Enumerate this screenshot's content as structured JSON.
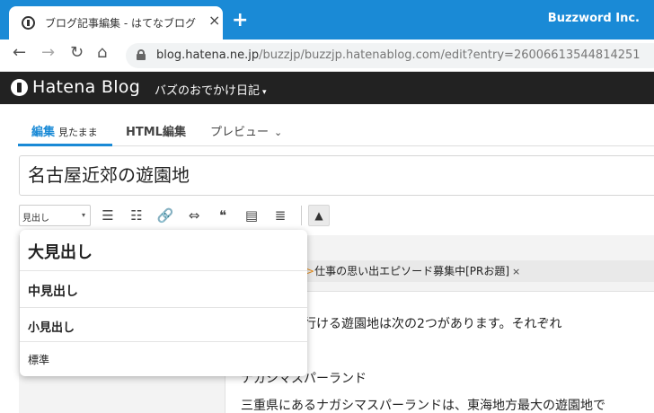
{
  "browser": {
    "tab_title": "ブログ記事編集 - はてなブログ",
    "tab_close": "×",
    "new_tab": "+",
    "profile": "Buzzword Inc.",
    "nav": {
      "back": "←",
      "forward": "→",
      "reload": "↻",
      "home": "⌂"
    },
    "url_host": "blog.hatena.ne.jp",
    "url_path": "/buzzjp/buzzjp.hatenablog.com/edit?entry=26006613544814251"
  },
  "header": {
    "logo": "Hatena Blog",
    "blog_name": "バズのおでかけ日記",
    "blog_caret": "▾"
  },
  "editor_tabs": {
    "visual": "編集",
    "visual_sub": "見たまま",
    "html": "HTML編集",
    "preview": "プレビュー",
    "preview_chevron": "⌄"
  },
  "title_field": {
    "value": "名古屋近郊の遊園地"
  },
  "toolbar": {
    "heading_select": "見出し",
    "heading_arrow": "▾",
    "icons": {
      "bullet_list": "☰",
      "numbered_list": "☷",
      "link": "🔗",
      "more": "⇔",
      "quote": "❝",
      "toc": "▤",
      "footnote": "≣"
    },
    "collapse": "▲"
  },
  "heading_menu": {
    "items": [
      "大見出し",
      "中見出し",
      "小見出し",
      "標準"
    ]
  },
  "theme": {
    "prefix": ">",
    "text": "仕事の思い出エピソード募集中[PRお題]",
    "close": "×"
  },
  "body": {
    "line1": "から手軽に行ける遊園地は次の2つがあります。それぞれ",
    "line2": "ナガシマスパーランド",
    "line3": "三重県にあるナガシマスパーランドは、東海地方最大の遊園地で"
  },
  "colors": {
    "browser_blue": "#1a8ad6",
    "hatena_header": "#222222",
    "accent_blue": "#1a8ad6",
    "theme_arrow": "#e28a1a"
  }
}
